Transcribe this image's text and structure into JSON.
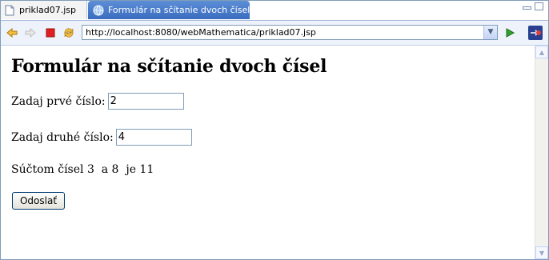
{
  "tabs": [
    {
      "label": "priklad07.jsp",
      "active": false
    },
    {
      "label": "Formulár na sčítanie dvoch čísel",
      "active": true
    }
  ],
  "tab_close_symbol": "✕",
  "address": {
    "url": "http://localhost:8080/webMathematica/priklad07.jsp"
  },
  "page": {
    "title": "Formulár na sčítanie dvoch čísel",
    "field1": {
      "label": "Zadaj prvé číslo:",
      "value": "2"
    },
    "field2": {
      "label": "Zadaj druhé číslo:",
      "value": "4"
    },
    "result_text": "Súčtom čísel 3  a 8  je 11",
    "submit_label": "Odoslať"
  },
  "icons": [
    "page-icon",
    "globe-icon",
    "back-icon",
    "forward-icon",
    "stop-icon",
    "refresh-icon",
    "go-icon",
    "navigator-icon",
    "minimize-icon",
    "maximize-icon",
    "chevron-down-icon"
  ],
  "colors": {
    "active_tab": "#3b6cc0",
    "stop": "#e02020",
    "go": "#2fa02f"
  }
}
